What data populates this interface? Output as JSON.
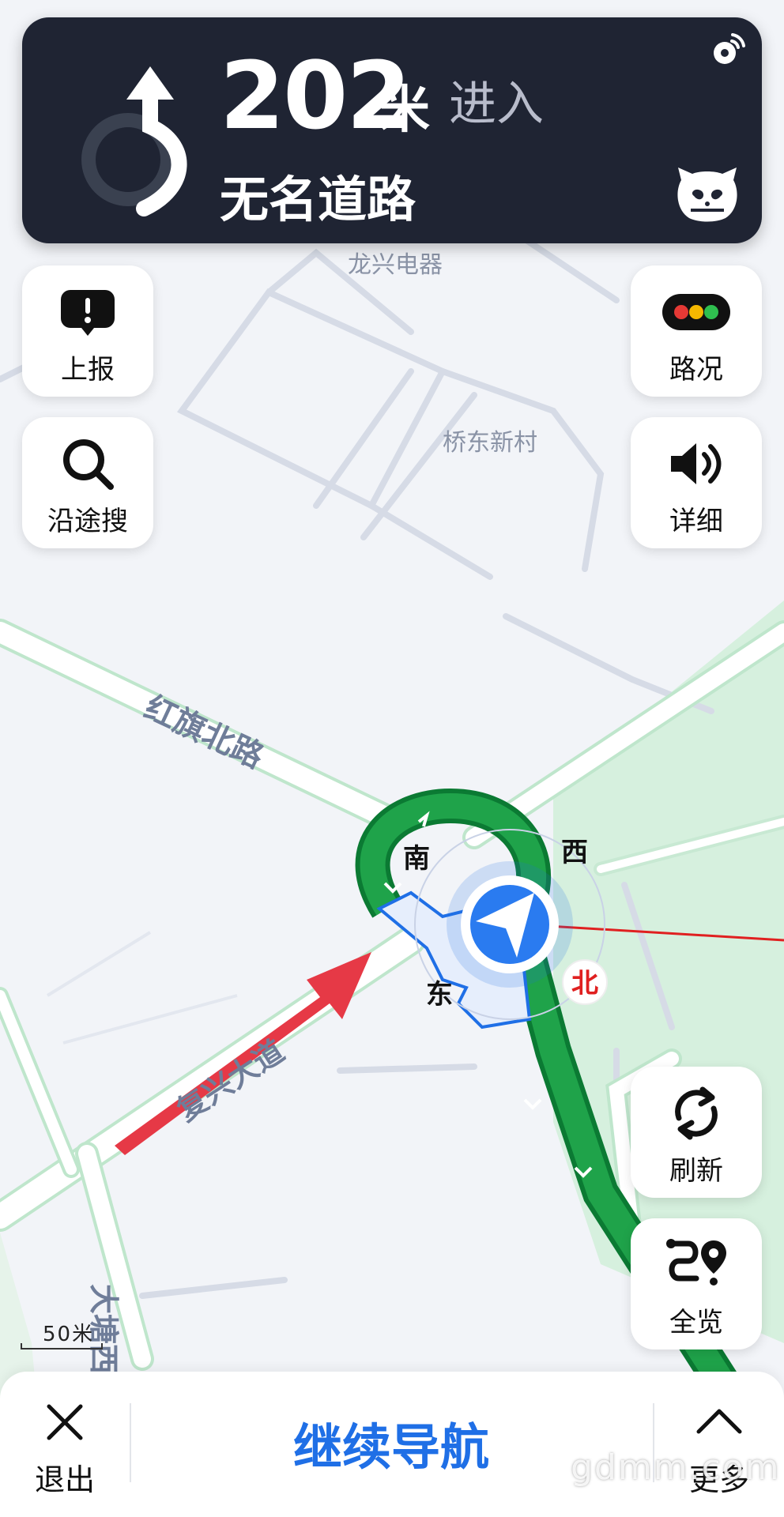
{
  "banner": {
    "distance_value": "202",
    "distance_unit": "米",
    "action": "进入",
    "road_name": "无名道路",
    "turn_icon": "u-turn-icon",
    "gps_icon": "satellite-signal-icon",
    "mascot_icon": "cat-mascot-icon"
  },
  "left_buttons": [
    {
      "label": "上报",
      "icon": "report-exclamation-icon"
    },
    {
      "label": "沿途搜",
      "icon": "search-icon"
    }
  ],
  "right_buttons": [
    {
      "label": "路况",
      "icon": "traffic-light-icon"
    },
    {
      "label": "详细",
      "icon": "speaker-icon"
    },
    {
      "label": "刷新",
      "icon": "refresh-icon"
    },
    {
      "label": "全览",
      "icon": "route-overview-icon"
    }
  ],
  "map": {
    "pois": [
      "龙兴电器",
      "桥东新村"
    ],
    "roads": [
      "红旗北路",
      "复兴大道",
      "大塘西"
    ],
    "compass": {
      "south": "南",
      "west": "西",
      "east": "东",
      "north": "北"
    },
    "colors": {
      "route": "#1fa34a",
      "route_outline": "#0b7a33",
      "greenspace": "#d6f0de",
      "arrow": "#e63946",
      "locator": "#1f6fe6"
    }
  },
  "scale": {
    "text": "50米"
  },
  "bottom_bar": {
    "exit_label": "退出",
    "continue_label": "继续导航",
    "more_label": "更多"
  },
  "watermark": "gdmm.com"
}
